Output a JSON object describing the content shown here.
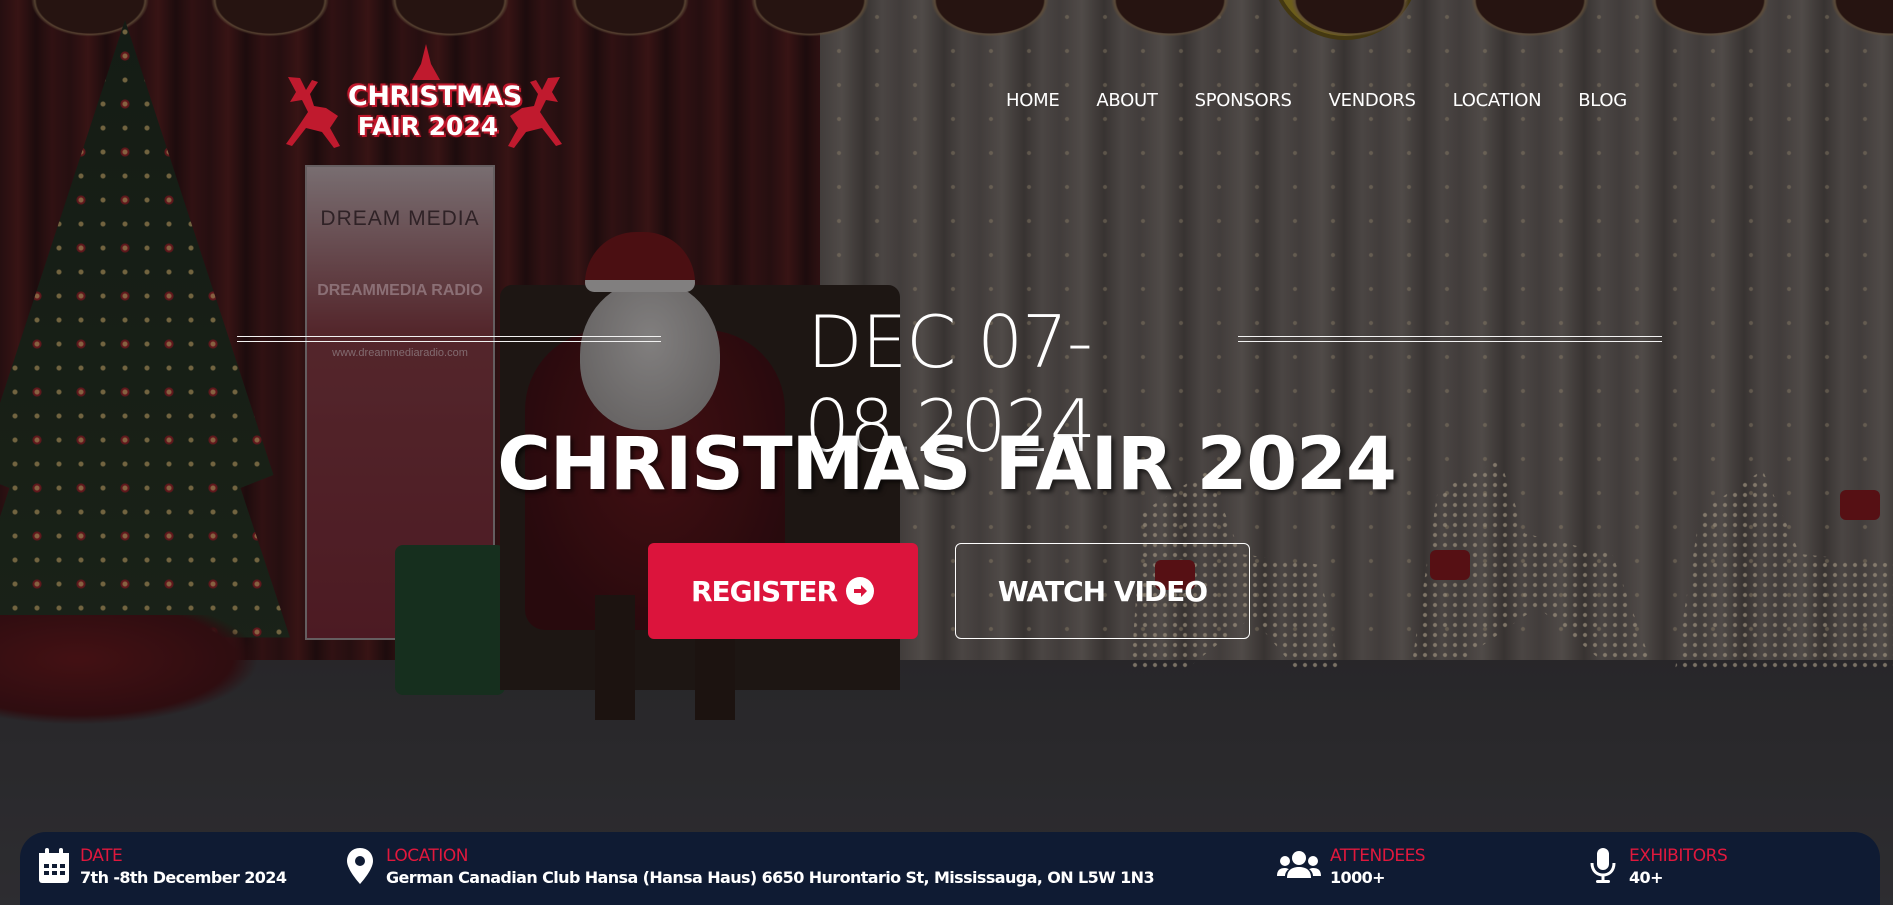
{
  "colors": {
    "accent": "#dc143c",
    "info_bar_bg": "#0f1b33",
    "info_label": "#e0183d",
    "text": "#ffffff"
  },
  "logo": {
    "line1": "CHRISTMAS",
    "line2": "FAIR 2024",
    "icon": "reindeer-icon"
  },
  "nav": {
    "items": [
      "HOME",
      "ABOUT",
      "SPONSORS",
      "VENDORS",
      "LOCATION",
      "BLOG"
    ]
  },
  "banner": {
    "title": "DREAM MEDIA",
    "subtitle": "DREAMMEDIA RADIO",
    "url": "www.dreammediaradio.com"
  },
  "hero": {
    "date": "DEC 07-08,2024",
    "title": "CHRISTMAS FAIR 2024",
    "register_label": "REGISTER",
    "register_icon": "arrow-circle-right-icon",
    "watch_label": "WATCH VIDEO"
  },
  "info": {
    "date": {
      "label": "DATE",
      "value": "7th -8th December 2024",
      "icon": "calendar-icon"
    },
    "location": {
      "label": "LOCATION",
      "value": "German Canadian Club Hansa (Hansa Haus) 6650 Hurontario St, Mississauga, ON L5W 1N3",
      "icon": "map-pin-icon"
    },
    "attendees": {
      "label": "ATTENDEES",
      "value": "1000+",
      "icon": "users-icon"
    },
    "exhibitors": {
      "label": "EXHIBITORS",
      "value": "40+",
      "icon": "microphone-icon"
    }
  }
}
